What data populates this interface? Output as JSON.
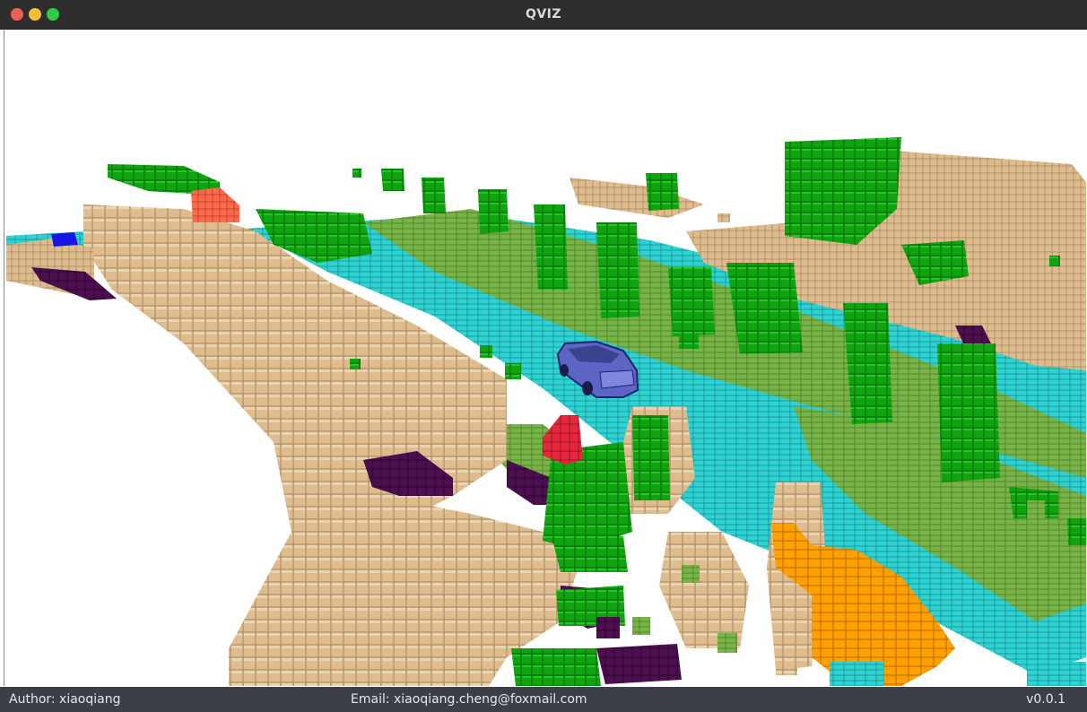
{
  "window": {
    "title": "QVIZ"
  },
  "viewport": {
    "description": "3D voxel occupancy visualization",
    "legend_colors": {
      "building": "#dfbc8e",
      "vegetation": "#0fa30f",
      "road": "#2ed2d2",
      "terrain": "#77b347",
      "sidewalk": "#4b0f4f",
      "car": "#5c64c4",
      "traffic_cone": "#ff9f00",
      "person": "#e6283c",
      "other": "#ff6a4c",
      "pole": "#1515e6"
    }
  },
  "statusbar": {
    "author": "Author: xiaoqiang",
    "email": "Email: xiaoqiang.cheng@foxmail.com",
    "version": "v0.0.1"
  }
}
